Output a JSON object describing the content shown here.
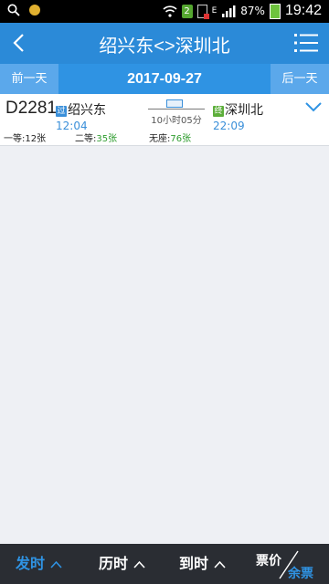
{
  "status_bar": {
    "battery": "87%",
    "time": "19:42",
    "notif_badge": "2",
    "network_type": "E"
  },
  "header": {
    "title": "绍兴东<>深圳北"
  },
  "date_nav": {
    "prev_label": "前一天",
    "date": "2017-09-27",
    "next_label": "后一天"
  },
  "trains": [
    {
      "number": "D2281",
      "departure": {
        "badge": "过",
        "station": "绍兴东",
        "time": "12:04"
      },
      "arrival": {
        "badge": "终",
        "station": "深圳北",
        "time": "22:09"
      },
      "duration": "10小时05分",
      "seats": [
        {
          "label": "一等:",
          "count": "12张"
        },
        {
          "label": "二等:",
          "count": "35张"
        },
        {
          "label": "无座:",
          "count": "76张"
        }
      ]
    }
  ],
  "bottom_bar": {
    "sort_departure": "发时",
    "sort_duration": "历时",
    "sort_arrival": "到时",
    "price_label": "票价",
    "remaining_label": "余票"
  },
  "colors": {
    "accent": "#2f93e3",
    "header": "#2b8ad8",
    "seat_count": "#2e9c2e",
    "bottom_bar": "#2a2d33"
  }
}
